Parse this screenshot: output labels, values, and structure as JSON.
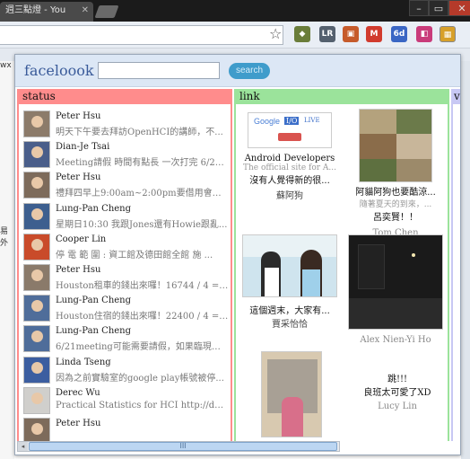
{
  "browser": {
    "tab_title": "週三點燈 - You",
    "tab_close": "✕"
  },
  "left_page_fragments": [
    "wx",
    "易外"
  ],
  "popup": {
    "brand": "faceloook",
    "search_placeholder": "",
    "search_button": "search"
  },
  "columns": {
    "status": "status",
    "link": "link",
    "third": "v"
  },
  "statuses": [
    {
      "name": "Peter Hsu",
      "text": "明天下午要去拜訪OpenHCI的講師，不..."
    },
    {
      "name": "Dian-Je Tsai",
      "text": "Meeting請假 時間有點長 一次打完 6/21 ..."
    },
    {
      "name": "Peter Hsu",
      "text": "禮拜四早上9:00am~2:00pm要借用會議..."
    },
    {
      "name": "Lung-Pan Cheng",
      "text": "星期日10:30 我跟Jones還有Howie跟亂..."
    },
    {
      "name": "Cooper Lin",
      "text": "停 電 範 圍 : 資工館及德田館全館 施 ..."
    },
    {
      "name": "Peter Hsu",
      "text": "Houston租車的錢出來囉！16744 / 4 = 4..."
    },
    {
      "name": "Lung-Pan Cheng",
      "text": "Houston住宿的錢出來囉！22400 / 4 = 5..."
    },
    {
      "name": "Lung-Pan Cheng",
      "text": "6/21meeting可能需要請假，如果臨現來..."
    },
    {
      "name": "Linda Tseng",
      "text": "因為之前實驗室的google play帳號被停..."
    },
    {
      "name": "Derec Wu",
      "text": "Practical Statistics for HCI http://depts.wa..."
    },
    {
      "name": "Peter Hsu",
      "text": ""
    }
  ],
  "links": [
    {
      "thumb": "google-io-live",
      "title": "Android Developers",
      "sub": "The official site for A...",
      "caption": "沒有人覺得新的很...",
      "name": "蘇阿狗"
    },
    {
      "thumb": "dog-grid",
      "title": "阿貓阿狗也要酷涼...",
      "sub": "隨著夏天的到來，...",
      "caption": "呂奕賢！！",
      "name": "Tom Chen"
    },
    {
      "thumb": "couple-photo",
      "title": "這個週末，大家有...",
      "sub": "",
      "caption": "",
      "name": "賈采怡恰"
    },
    {
      "thumb": "night-street",
      "title": "",
      "sub": "",
      "caption": "",
      "name": "Alex Nien-Yi Ho"
    },
    {
      "thumb": "girl-stairs",
      "title": "跳!!!",
      "sub": "",
      "caption": "良班太可愛了XD",
      "name": "Lucy Lin"
    }
  ],
  "google_badge": {
    "word": "Google",
    "io": "I/O",
    "live": "LIVE"
  },
  "scroll": {
    "thumb_label": "III",
    "left_arrow": "◂"
  },
  "colors": {
    "status_header": "#ff8c8c",
    "link_header": "#9be39b",
    "third_header": "#c8c8f4",
    "search_button": "#3f9ccb",
    "brand": "#3a5b9a"
  }
}
